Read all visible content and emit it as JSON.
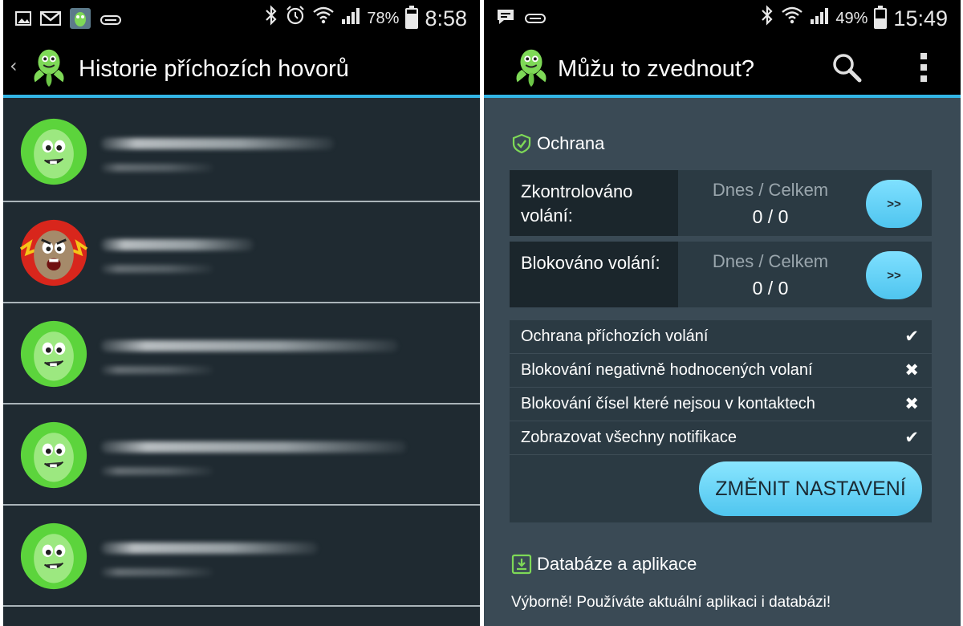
{
  "left_screen": {
    "statusbar": {
      "icons_left": [
        "picture-icon",
        "gmail-icon",
        "app-icon",
        "usb-icon"
      ],
      "battery": "78%",
      "battery_level": 0.78,
      "time": "8:58"
    },
    "actionbar": {
      "back_glyph": "‹",
      "title": "Historie příchozích hovorů"
    },
    "calls": [
      {
        "avatar": "green-bean-avatar",
        "avatar_color": "#5cd43c"
      },
      {
        "avatar": "red-angry-bean-avatar",
        "avatar_color": "#d8261c"
      },
      {
        "avatar": "green-bean-avatar",
        "avatar_color": "#5cd43c"
      },
      {
        "avatar": "green-bean-avatar",
        "avatar_color": "#5cd43c"
      },
      {
        "avatar": "green-bean-avatar",
        "avatar_color": "#5cd43c"
      }
    ]
  },
  "right_screen": {
    "statusbar": {
      "battery": "49%",
      "battery_level": 0.49,
      "time": "15:49"
    },
    "actionbar": {
      "title": "Můžu to zvednout?",
      "search_icon": "search-icon",
      "menu_icon": "overflow-menu-icon"
    },
    "protection": {
      "heading": "Ochrana",
      "stats": [
        {
          "label": "Zkontrolováno volání:",
          "caption": "Dnes / Celkem",
          "value": "0 / 0",
          "button": ">>"
        },
        {
          "label": "Blokováno volání:",
          "caption": "Dnes / Celkem",
          "value": "0 / 0",
          "button": ">>"
        }
      ],
      "settings": [
        {
          "label": "Ochrana příchozích volání",
          "mark": "✔",
          "enabled": true
        },
        {
          "label": "Blokování negativně hodnocených volaní",
          "mark": "✖",
          "enabled": false
        },
        {
          "label": "Blokování čísel které nejsou v kontaktech",
          "mark": "✖",
          "enabled": false
        },
        {
          "label": "Zobrazovat všechny notifikace",
          "mark": "✔",
          "enabled": true
        }
      ],
      "change_button": "ZMĚNIT NASTAVENÍ"
    },
    "database": {
      "heading": "Databáze a aplikace",
      "status": "Výborně! Používáte aktuální aplikaci i databázi!"
    }
  },
  "colors": {
    "accent": "#33b5e5",
    "button": "#4fc5ef",
    "list_bg": "#1f2a31",
    "panel_bg": "#3a4a55",
    "icon_green": "#7ed957"
  }
}
